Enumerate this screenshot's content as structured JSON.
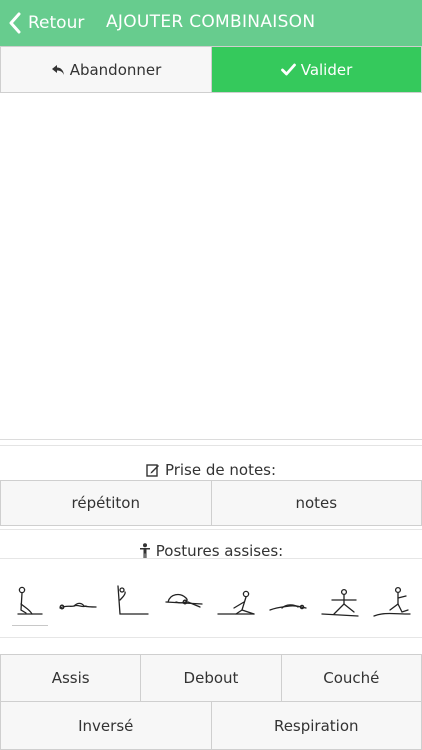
{
  "header": {
    "back_label": "Retour",
    "title": "AJOUTER COMBINAISON"
  },
  "actions": {
    "abandon_label": "Abandonner",
    "validate_label": "Valider"
  },
  "notes": {
    "title": "Prise de notes:",
    "buttons": [
      "répétiton",
      "notes"
    ]
  },
  "postures": {
    "title": "Postures assises:",
    "icons": [
      "seated-pose-1-icon",
      "seated-pose-2-icon",
      "seated-pose-3-icon",
      "seated-pose-4-icon",
      "seated-pose-5-icon",
      "seated-pose-6-icon",
      "seated-pose-7-icon",
      "seated-pose-8-icon"
    ]
  },
  "categories": {
    "row1": [
      "Assis",
      "Debout",
      "Couché"
    ],
    "row2": [
      "Inversé",
      "Respiration"
    ]
  },
  "colors": {
    "header_bg": "#67cc8e",
    "validate_bg": "#35c95c",
    "button_bg": "#f7f7f7"
  }
}
